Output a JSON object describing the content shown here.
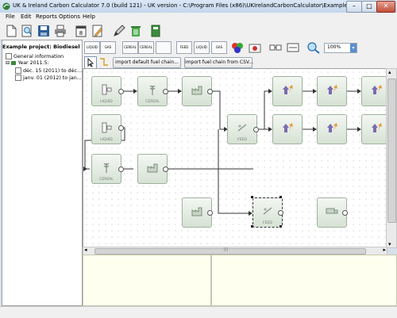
{
  "window": {
    "title": "UK & Ireland Carbon Calculator 7.0 (build 121) - UK version - C:\\Program Files (x86)\\UKIrelandCarbonCalculator\\ExampleBiofuel.rfa",
    "minimize_glyph": "–",
    "maximize_glyph": "□",
    "close_glyph": "✕"
  },
  "menu": {
    "items": [
      "File",
      "Edit",
      "Reports",
      "Options",
      "Help"
    ]
  },
  "project_panel": {
    "header": "Example project: Biodiesel Mi",
    "tree": [
      {
        "label": "General information",
        "level": 0
      },
      {
        "label": "Year 2011.5:",
        "level": 0,
        "toggle": "⊟"
      },
      {
        "label": "déc. 15 (2011) to déc....",
        "level": 1
      },
      {
        "label": "janv. 01 (2012) to jan...",
        "level": 1
      }
    ]
  },
  "toolbar": {
    "module_labels": [
      "LIQUID",
      "GAS",
      "CEREAL",
      "CEREAL",
      "",
      "FEED",
      "LIQUID",
      "GAS"
    ]
  },
  "zoom": {
    "value": "100%"
  },
  "actions": {
    "import_default": "import default fuel chain...",
    "import_csv": "import fuel chain from CSV..."
  },
  "nodes": {
    "liquid": "LIQUID",
    "cereal": "CEREAL",
    "feed": "FEED"
  },
  "scroll": {
    "left_arrow": "◂",
    "right_arrow": "▸",
    "up_arrow": "▴",
    "down_arrow": "▾",
    "grip": "|||"
  },
  "colors": {
    "canvas_bg": "#ffffff",
    "notes_bg": "#fffff0",
    "node_green": "#d6e2d4",
    "arrow_purple": "#7b6bb0",
    "arrow_orange": "#e89a3b"
  }
}
